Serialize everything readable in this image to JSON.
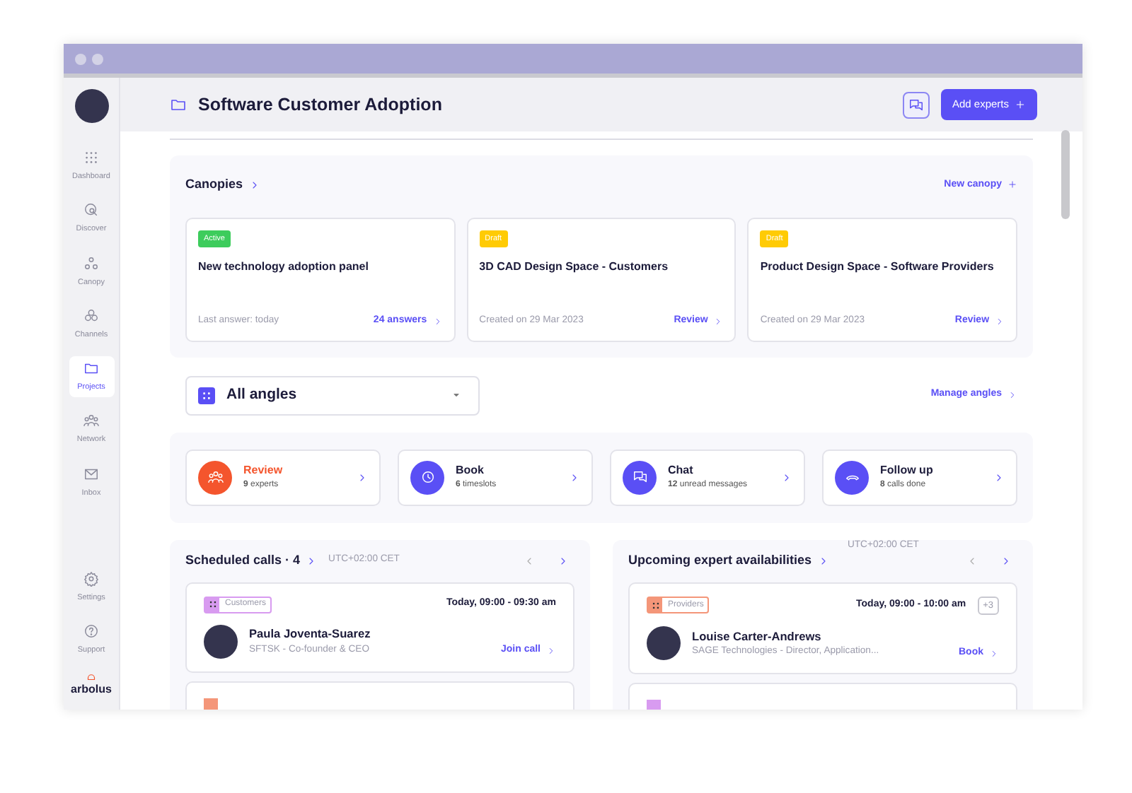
{
  "sidebar": {
    "items": [
      {
        "label": "Dashboard",
        "selected": false
      },
      {
        "label": "Discover",
        "selected": false
      },
      {
        "label": "Canopy",
        "selected": false
      },
      {
        "label": "Channels",
        "selected": false
      },
      {
        "label": "Projects",
        "selected": true
      },
      {
        "label": "Network",
        "selected": false
      },
      {
        "label": "Inbox",
        "selected": false
      }
    ],
    "bottom_items": [
      {
        "label": "Settings",
        "selected": false
      },
      {
        "label": "Support",
        "selected": false
      }
    ],
    "logo": "arbolus"
  },
  "header": {
    "title": "Software Customer Adoption",
    "button": "Add experts"
  },
  "canopies": {
    "title": "Canopies",
    "action": "New canopy",
    "cards": [
      {
        "status": "Active",
        "color": "#3dcc5c",
        "title": "New technology adoption panel",
        "meta": "Last answer: today",
        "link": "24 answers"
      },
      {
        "status": "Draft",
        "color": "#ffcb05",
        "title": "3D CAD Design Space  - Customers",
        "meta": "Created on 29 Mar 2023",
        "link": "Review"
      },
      {
        "status": "Draft",
        "color": "#ffcb05",
        "title": "Product Design Space - Software Providers",
        "meta": "Created on 29 Mar 2023",
        "link": "Review"
      }
    ]
  },
  "angles": {
    "dropdown": "All angles",
    "action": "Manage angles"
  },
  "actions": [
    {
      "title": "Review",
      "subtitle": "**9** experts",
      "color": "#f4552d",
      "highlighted": true
    },
    {
      "title": "Book",
      "subtitle": "**6** timeslots",
      "color": "#5a4ff5",
      "highlighted": false
    },
    {
      "title": "Chat",
      "subtitle": "**12** unread messages",
      "color": "#5a4ff5",
      "highlighted": false
    },
    {
      "title": "Follow up",
      "subtitle": "**8** calls done",
      "color": "#5a4ff5",
      "highlighted": false
    }
  ],
  "scheduled": {
    "title": "Scheduled calls · 4",
    "timezone": "UTC+02:00 CET",
    "cards": [
      {
        "tag": "Customers",
        "color": "#d89bf0",
        "time": "Today, 09:00 - 09:30 am",
        "name": "Paula Joventa-Suarez",
        "role": "SFTSK - Co-founder & CEO",
        "action": "Join call"
      }
    ],
    "partial_cards": [
      {
        "color": "#f49679"
      }
    ]
  },
  "availabilities": {
    "title": "Upcoming expert availabilities",
    "timezone": "UTC+02:00 CET",
    "cards": [
      {
        "tag": "Providers",
        "color": "#f49679",
        "time": "Today, 09:00 - 10:00 am",
        "more": "+3",
        "name": "Louise Carter-Andrews",
        "role": "SAGE Technologies - Director, Application...",
        "action": "Book"
      }
    ],
    "partial_cards": [
      {
        "color": "#d89bf0"
      }
    ]
  }
}
